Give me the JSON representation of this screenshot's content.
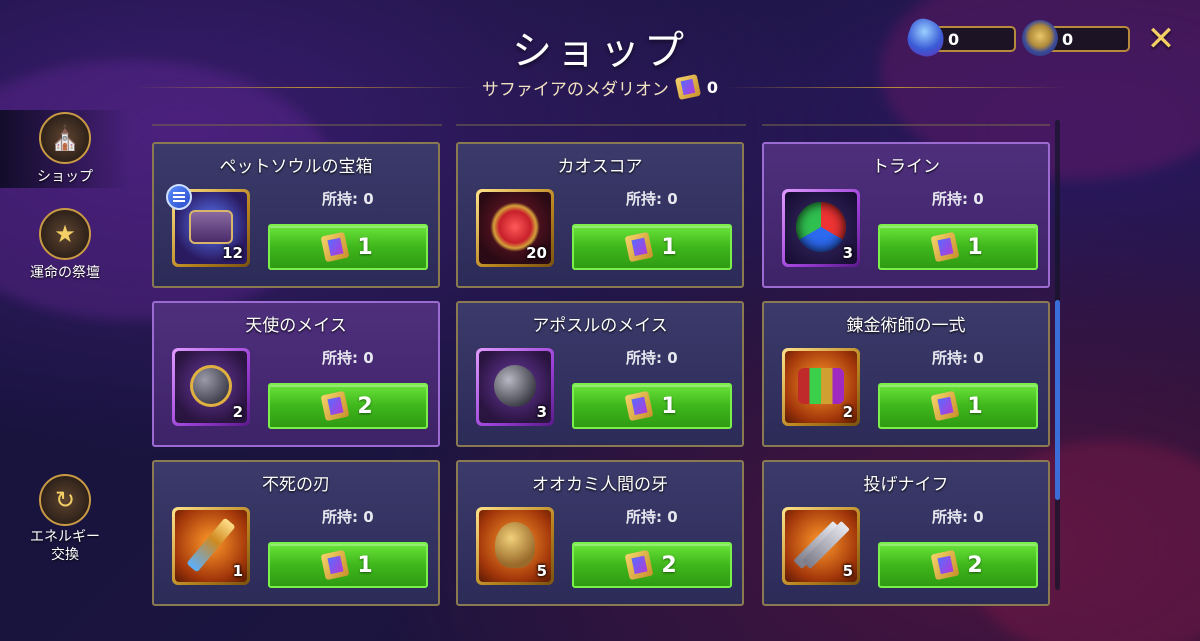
{
  "header": {
    "title": "ショップ",
    "subtitle": "サファイアのメダリオン",
    "subtitle_count": "0",
    "close_label": "✕"
  },
  "currencies": [
    {
      "icon": "energy-crystal-icon",
      "value": "0"
    },
    {
      "icon": "medal-badge-icon",
      "value": "0"
    }
  ],
  "sidenav": {
    "items": [
      {
        "label": "ショップ",
        "icon": "shop-icon",
        "active": true
      },
      {
        "label": "運命の祭壇",
        "icon": "star-altar-icon",
        "active": false
      },
      {
        "label": "エネルギー\n交換",
        "icon": "energy-exchange-icon",
        "active": false
      }
    ]
  },
  "owned_prefix": "所持: ",
  "items": [
    {
      "name": "ペットソウルの宝箱",
      "owned": "所持: 0",
      "qty": "12",
      "price": "1",
      "rarity": "gold",
      "art": "chest",
      "bg": "purple"
    },
    {
      "name": "カオスコア",
      "owned": "所持: 0",
      "qty": "20",
      "price": "1",
      "rarity": "gold",
      "art": "core",
      "bg": "blue"
    },
    {
      "name": "トライン",
      "owned": "所持: 0",
      "qty": "3",
      "price": "1",
      "rarity": "violet",
      "art": "orb",
      "bg": "purple"
    },
    {
      "name": "天使のメイス",
      "owned": "所持: 0",
      "qty": "2",
      "price": "2",
      "rarity": "violet",
      "art": "mace",
      "bg": "purple"
    },
    {
      "name": "アポスルのメイス",
      "owned": "所持: 0",
      "qty": "3",
      "price": "1",
      "rarity": "violet",
      "art": "mace-dark",
      "bg": "blue"
    },
    {
      "name": "錬金術師の一式",
      "owned": "所持: 0",
      "qty": "2",
      "price": "1",
      "rarity": "gold",
      "art": "potions",
      "bg": "blue"
    },
    {
      "name": "不死の刃",
      "owned": "所持: 0",
      "qty": "1",
      "price": "1",
      "rarity": "gold",
      "art": "blade",
      "bg": "blue"
    },
    {
      "name": "オオカミ人間の牙",
      "owned": "所持: 0",
      "qty": "5",
      "price": "2",
      "rarity": "gold",
      "art": "fang",
      "bg": "blue"
    },
    {
      "name": "投げナイフ",
      "owned": "所持: 0",
      "qty": "5",
      "price": "2",
      "rarity": "gold",
      "art": "knives",
      "bg": "blue"
    }
  ],
  "colors": {
    "buy_button": "#3fb71c",
    "gold_frame": "#c8902a",
    "violet_frame": "#9b3fd6",
    "scroll_thumb": "#3b6dd9"
  }
}
